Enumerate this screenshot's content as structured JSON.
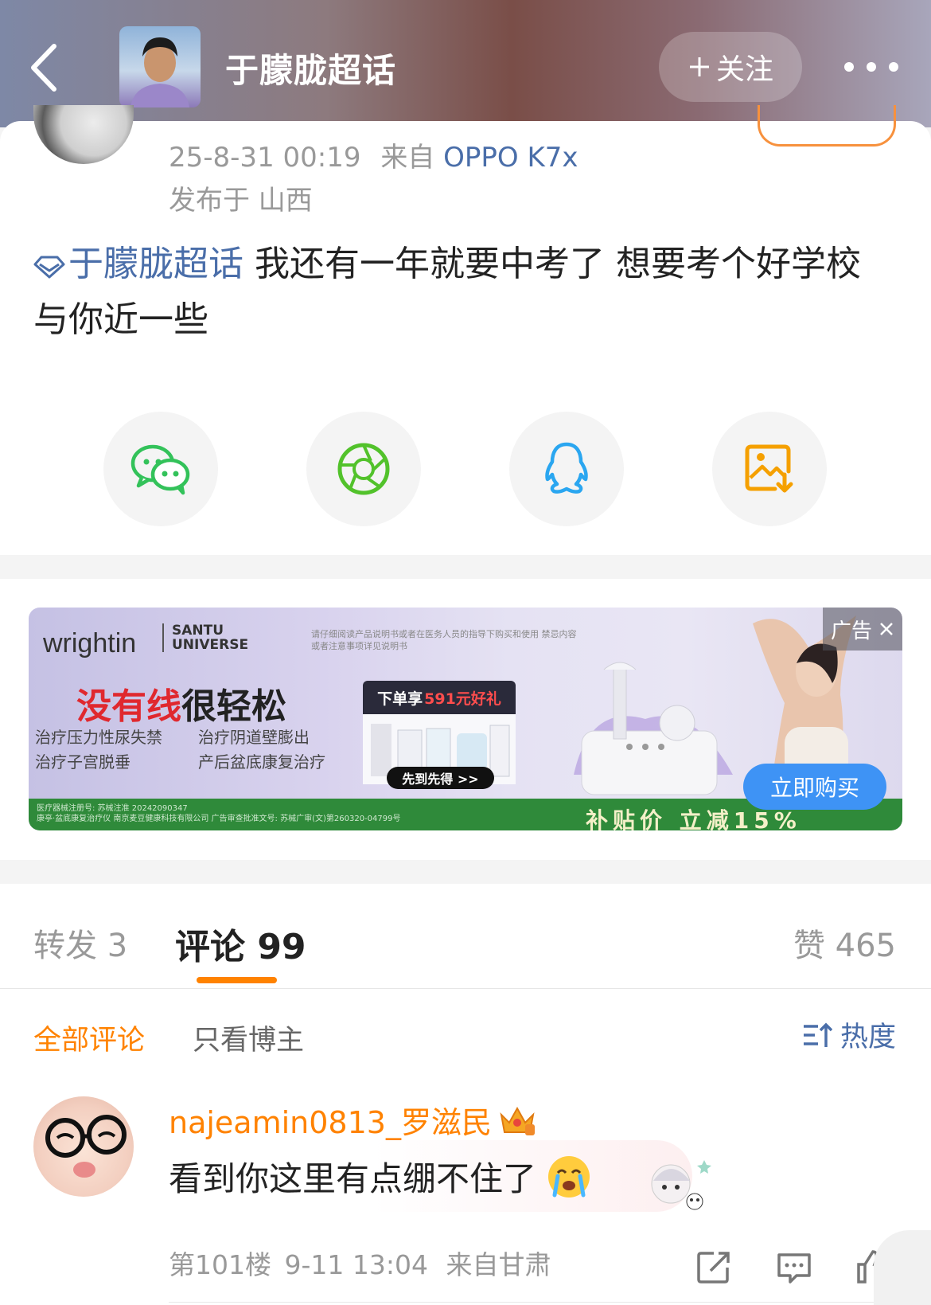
{
  "header": {
    "title": "于朦胧超话",
    "follow_label": "关注",
    "back_icon": "chevron-left-icon",
    "more_icon": "more-dots-icon"
  },
  "post": {
    "time": "25-8-31 00:19",
    "from_label": "来自",
    "device": "OPPO K7x",
    "location": "发布于 山西",
    "topic": "于朦胧超话",
    "text": " 我还有一年就要中考了 想要考个好学校 与你近一些"
  },
  "share": [
    {
      "name": "wechat",
      "icon": "wechat-icon",
      "color": "#33c25a"
    },
    {
      "name": "moments",
      "icon": "moments-icon",
      "color": "#52c22b"
    },
    {
      "name": "qq",
      "icon": "qq-icon",
      "color": "#2aa6f0"
    },
    {
      "name": "save-image",
      "icon": "save-image-icon",
      "color": "#f5a000"
    }
  ],
  "ad": {
    "brand": "wrightin",
    "brand2_line1": "SANTU",
    "brand2_line2": "UNIVERSE",
    "fine_print": "请仔细阅读产品说明书或者在医务人员的指导下购买和使用 禁忌内容或者注意事项详见说明书",
    "headline_red": "没有线",
    "headline_dark": "很轻松",
    "bullets": [
      "治疗压力性尿失禁",
      "治疗阴道壁膨出",
      "治疗子宫脱垂",
      "产后盆底康复治疗"
    ],
    "promo_prefix": "下单享",
    "promo_red": "591元好礼",
    "grab_label": "先到先得 >>",
    "strip_fine_line1": "医疗器械注册号: 苏械注准 20242090347",
    "strip_fine_line2": "康亭·盆底康复治疗仪 南京麦豆健康科技有限公司      广告审查批准文号: 苏械广审(文)第260320-04799号",
    "strip_text": "补贴价 立减15%",
    "tag": "广告",
    "buy_label": "立即购买"
  },
  "tabs": {
    "repost": "转发 3",
    "comment": "评论 99",
    "like": "赞 465"
  },
  "comments": {
    "filter_all": "全部评论",
    "filter_owner": "只看博主",
    "sort_label": "热度",
    "items": [
      {
        "username": "najeamin0813_罗滋民",
        "text": "看到你这里有点绷不住了",
        "floor": "第101楼",
        "time": "9-11 13:04",
        "from": "来自甘肃"
      }
    ]
  }
}
